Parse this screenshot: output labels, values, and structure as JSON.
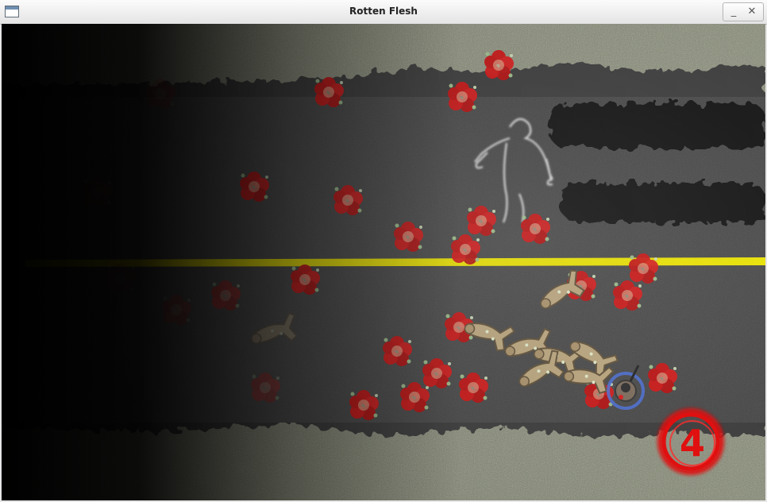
{
  "window": {
    "title": "Rotten Flesh",
    "icons": {
      "app": "window-icon",
      "minimize": "minimize-icon",
      "close": "close-icon"
    },
    "minimize_glyph": "_",
    "close_glyph": "✕"
  },
  "game": {
    "scene": "top-down night road",
    "hud": {
      "lives": "4",
      "lives_color": "#e01010"
    },
    "colors": {
      "road": "#3a3a3a",
      "lane_line": "#e8e000",
      "grass": "#8a8f74",
      "blood": "#d81818",
      "zombie": "#b8a27a",
      "player_ring": "#4a6fd8"
    }
  }
}
